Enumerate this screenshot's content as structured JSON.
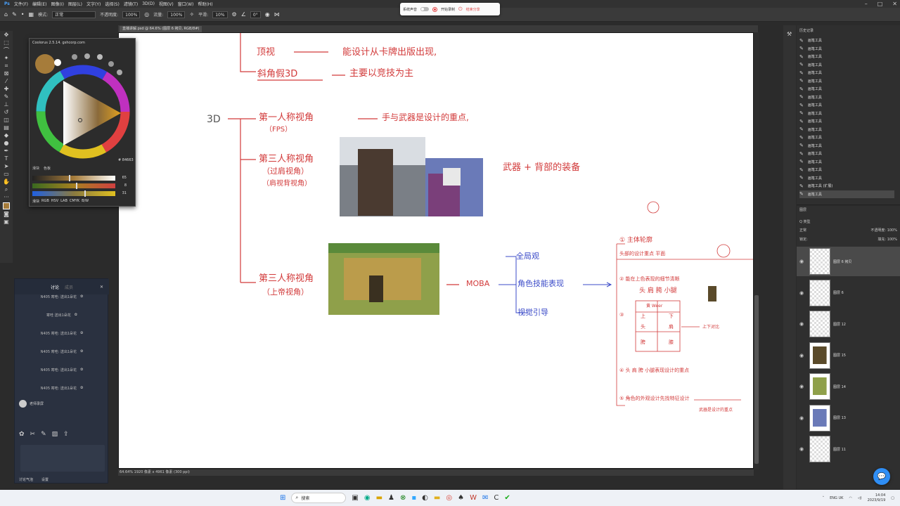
{
  "menu": [
    "文件(F)",
    "编辑(E)",
    "图像(I)",
    "图层(L)",
    "文字(Y)",
    "选择(S)",
    "滤镜(T)",
    "3D(D)",
    "视图(V)",
    "窗口(W)",
    "帮助(H)"
  ],
  "options_bar": {
    "mode_label": "模式:",
    "mode_value": "正常",
    "opacity_label": "不透明度:",
    "opacity_value": "100%",
    "flow_label": "流量:",
    "flow_value": "100%",
    "smooth_label": "平滑:",
    "smooth_value": "10%",
    "angle_value": "0°"
  },
  "recorder": {
    "system_audio": "系统声音",
    "start_record": "开始录制",
    "end_share": "结束分享"
  },
  "document": {
    "tab": "直播讲解.psd @ 64.6% (图层 6 拷贝, RGB/8#)",
    "status": "64.64%  1920 像素 x 4961 像素 (300 ppi)"
  },
  "canvas_text": {
    "top_view": "顶视",
    "top_view_note": "能设计从卡牌出版出现,",
    "iso": "斜角假3D",
    "iso_note": "主要以竞技为主",
    "threeD": "3D",
    "fps": "第一人称视角",
    "fps_sub": "（FPS）",
    "fps_note": "手与武器是设计的重点,",
    "tps": "第三人称视角",
    "tps_sub1": "（过肩视角）",
    "tps_sub2": "（肩视背视角）",
    "weapons_note": "武器  +  背部的装备",
    "top_down": "第三人称视角",
    "top_down_sub": "（上帝视角）",
    "moba": "MOBA",
    "moba_item1": "全局观",
    "moba_item2": "角色技能表现",
    "moba_item3": "视觉引导",
    "note1": "① 主体轮廓",
    "note1b": "头部的设计重点 平面",
    "note2": "② 能在上色表现的细节清晰",
    "note2b": "头 肩 胯 小腿",
    "note3": "③",
    "note_table_head": "黄 Weer",
    "note_t1": "上",
    "note_t2": "下",
    "note_t3": "头",
    "note_t4": "肩",
    "note_t5": "胯",
    "note_t6": "膝",
    "note_side": "上下对比",
    "note4": "④ 头 肩 胯 小腿表现设计的重点",
    "note5": "⑤ 角色的外观设计先找特征设计",
    "note5b": "武器是设计的重点"
  },
  "color_panel": {
    "title": "Coolorus 2.5.14. gshcorp.com",
    "hex": "# 84663",
    "tabs": [
      "滑块",
      "色板"
    ],
    "sliders": [
      {
        "value": "65"
      },
      {
        "value": "8"
      },
      {
        "value": "31"
      }
    ],
    "modes": [
      "滑块",
      "RGB",
      "HSV",
      "LAB",
      "CMYK",
      "B/W"
    ]
  },
  "chat": {
    "tabs": [
      "讨论",
      "成员"
    ],
    "messages": [
      "N405 寄哇: 送出1朵花",
      "寄哇 送出1朵花",
      "N405 寄哇: 送出1朵花",
      "N405 寄哇: 送出1朵花",
      "N405 寄哇: 送出1朵花",
      "N405 寄哇: 送出1朵花"
    ],
    "user_line": "老师录屏",
    "bottom": [
      "讨论气泡",
      "设置"
    ]
  },
  "history": {
    "title": "历史记录",
    "items": [
      "画笔工具",
      "画笔工具",
      "画笔工具",
      "画笔工具",
      "画笔工具",
      "画笔工具",
      "画笔工具",
      "画笔工具",
      "画笔工具",
      "画笔工具",
      "画笔工具",
      "画笔工具",
      "画笔工具",
      "画笔工具",
      "画笔工具",
      "画笔工具",
      "画笔工具",
      "画笔工具",
      "画笔工具 (扩展)",
      "画笔工具"
    ]
  },
  "layers": {
    "title": "图层",
    "filter": "Q 类型",
    "blend": "正常",
    "opacity": "不透明度: 100%",
    "lock": "锁定:",
    "fill": "填充: 100%",
    "items": [
      "图层 6 拷贝",
      "图层 6",
      "图层 12",
      "图层 15",
      "图层 14",
      "图层 13",
      "图层 11"
    ]
  },
  "taskbar": {
    "search": "搜索",
    "lang": "ENG UK",
    "time": "14:04",
    "date": "2023/9/19"
  }
}
